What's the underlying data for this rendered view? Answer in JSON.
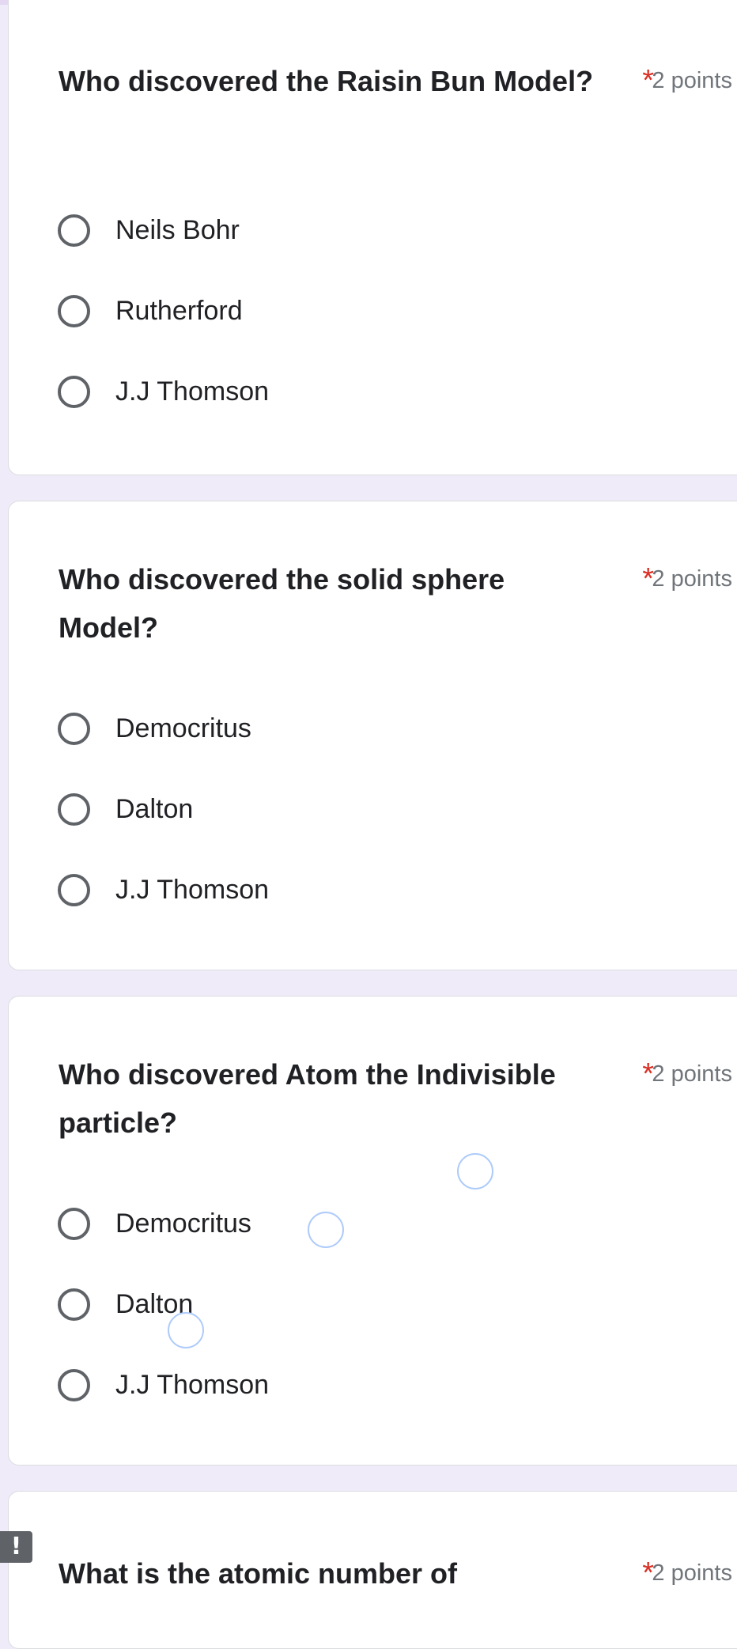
{
  "questions": [
    {
      "title": "Who discovered the Raisin Bun Model?",
      "required_mark": "*",
      "points": "2 points",
      "options": [
        "Neils Bohr",
        "Rutherford",
        "J.J Thomson"
      ]
    },
    {
      "title": "Who discovered the solid sphere Model?",
      "required_mark": "*",
      "points": "2 points",
      "options": [
        "Democritus",
        "Dalton",
        "J.J Thomson"
      ]
    },
    {
      "title": "Who discovered Atom the Indivisible particle?",
      "required_mark": "*",
      "points": "2 points",
      "options": [
        "Democritus",
        "Dalton",
        "J.J Thomson"
      ]
    },
    {
      "title": "What is the atomic number of",
      "required_mark": "*",
      "points": "2 points",
      "options": []
    }
  ],
  "error_badge": "!",
  "colors": {
    "page_background": "#f0ebf8",
    "card_background": "#ffffff",
    "required_star": "#d93025",
    "points_text": "#70757a",
    "radio_border": "#5f6368",
    "ripple_outline": "#aecbfa"
  },
  "icons": {
    "radio": "radio-unchecked-icon",
    "error": "error-icon"
  }
}
